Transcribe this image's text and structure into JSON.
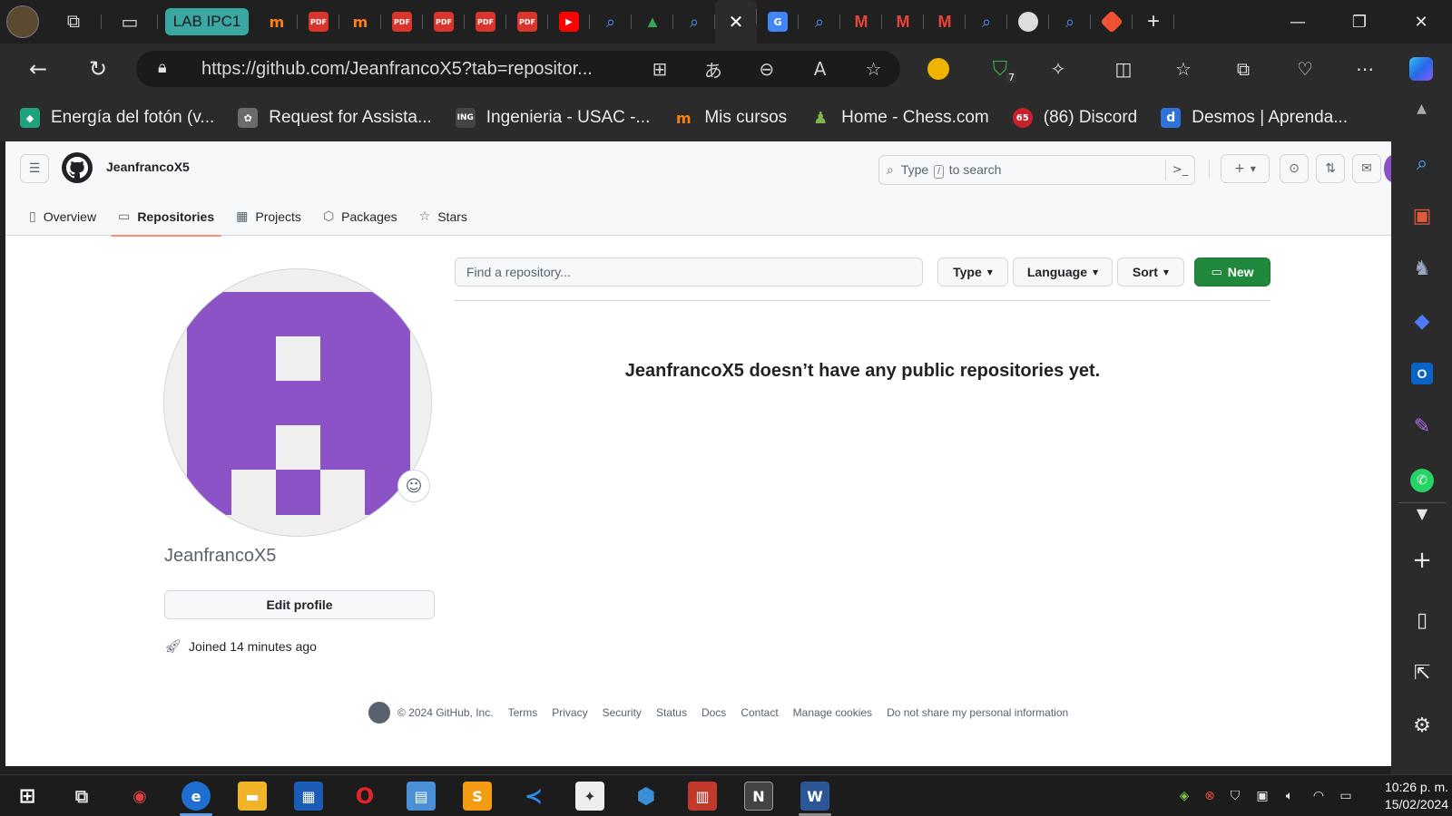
{
  "browser": {
    "first_tab_label": "LAB IPC1",
    "url": "https://github.com/JeanfrancoX5?tab=repositor...",
    "extension_badge": "7",
    "favorites": [
      {
        "label": "Energía del fotón (v...",
        "icon": "wizeline-icon",
        "color": "#1fa37f"
      },
      {
        "label": "Request for Assista...",
        "icon": "openai-icon",
        "color": "#6b6b6b"
      },
      {
        "label": "Ingenieria - USAC -...",
        "icon": "ing-icon",
        "color": "#444444"
      },
      {
        "label": "Mis cursos",
        "icon": "moodle-icon",
        "color": "#f98012"
      },
      {
        "label": "Home - Chess.com",
        "icon": "chess-icon",
        "color": "#81b64c"
      },
      {
        "label": "(86) Discord",
        "icon": "discord-icon",
        "color": "#c8212c"
      },
      {
        "label": "Desmos | Aprenda...",
        "icon": "desmos-icon",
        "color": "#2f72dc"
      }
    ],
    "discord_badge": "65"
  },
  "github": {
    "username": "JeanfrancoX5",
    "search_prefix": "Type",
    "search_key": "/",
    "search_suffix": "to search",
    "tabs": [
      {
        "label": "Overview",
        "icon": "book-icon"
      },
      {
        "label": "Repositories",
        "icon": "repo-icon",
        "selected": true
      },
      {
        "label": "Projects",
        "icon": "table-icon"
      },
      {
        "label": "Packages",
        "icon": "package-icon"
      },
      {
        "label": "Stars",
        "icon": "star-icon"
      }
    ],
    "profile": {
      "login": "JeanfrancoX5",
      "edit_label": "Edit profile",
      "joined": "Joined 14 minutes ago",
      "avatar_color": "#8c53c6"
    },
    "repos": {
      "find_placeholder": "Find a repository...",
      "type_label": "Type",
      "language_label": "Language",
      "sort_label": "Sort",
      "new_label": "New",
      "empty_message": "JeanfrancoX5 doesn’t have any public repositories yet."
    },
    "footer": {
      "copyright": "© 2024 GitHub, Inc.",
      "links": [
        "Terms",
        "Privacy",
        "Security",
        "Status",
        "Docs",
        "Contact",
        "Manage cookies",
        "Do not share my personal information"
      ]
    }
  },
  "taskbar": {
    "time": "10:26 p. m.",
    "date": "15/02/2024"
  }
}
